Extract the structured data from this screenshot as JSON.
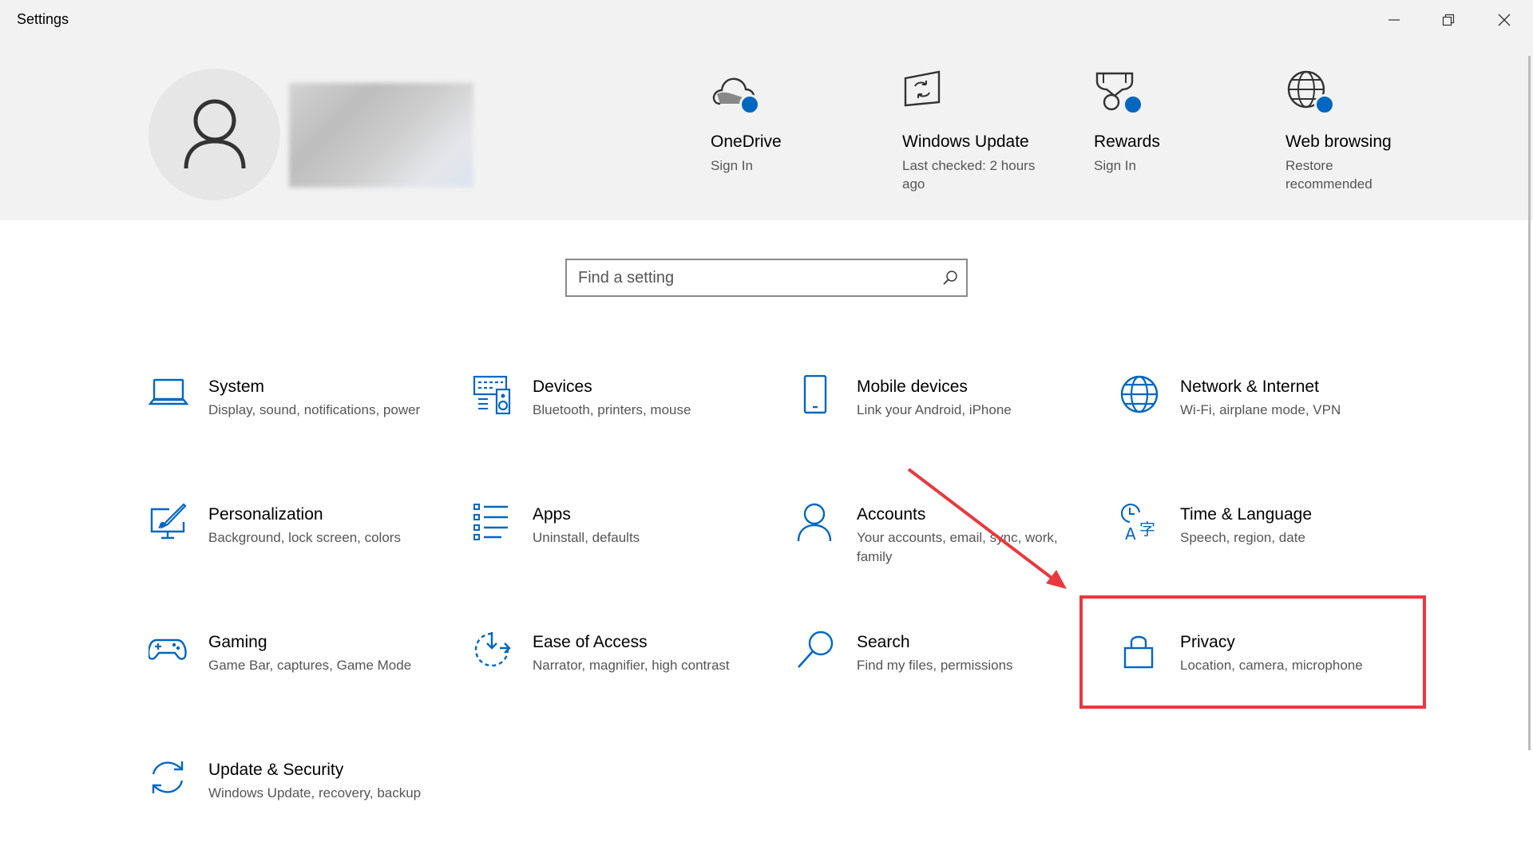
{
  "window": {
    "title": "Settings"
  },
  "header": {
    "quick_tiles": [
      {
        "title": "OneDrive",
        "subtitle": "Sign In",
        "icon": "onedrive-cloud-icon"
      },
      {
        "title": "Windows Update",
        "subtitle": "Last checked: 2 hours ago",
        "icon": "windows-update-icon"
      },
      {
        "title": "Rewards",
        "subtitle": "Sign In",
        "icon": "rewards-trophy-icon"
      },
      {
        "title": "Web browsing",
        "subtitle": "Restore recommended",
        "icon": "globe-icon"
      }
    ]
  },
  "search": {
    "placeholder": "Find a setting",
    "value": ""
  },
  "categories": [
    {
      "title": "System",
      "subtitle": "Display, sound, notifications, power",
      "icon": "laptop-icon"
    },
    {
      "title": "Devices",
      "subtitle": "Bluetooth, printers, mouse",
      "icon": "keyboard-speaker-icon"
    },
    {
      "title": "Mobile devices",
      "subtitle": "Link your Android, iPhone",
      "icon": "phone-icon"
    },
    {
      "title": "Network & Internet",
      "subtitle": "Wi-Fi, airplane mode, VPN",
      "icon": "globe-icon"
    },
    {
      "title": "Personalization",
      "subtitle": "Background, lock screen, colors",
      "icon": "paint-brush-icon"
    },
    {
      "title": "Apps",
      "subtitle": "Uninstall, defaults",
      "icon": "apps-list-icon"
    },
    {
      "title": "Accounts",
      "subtitle": "Your accounts, email, sync, work, family",
      "icon": "person-icon"
    },
    {
      "title": "Time & Language",
      "subtitle": "Speech, region, date",
      "icon": "clock-language-icon"
    },
    {
      "title": "Gaming",
      "subtitle": "Game Bar, captures, Game Mode",
      "icon": "gamepad-icon"
    },
    {
      "title": "Ease of Access",
      "subtitle": "Narrator, magnifier, high contrast",
      "icon": "ease-of-access-icon"
    },
    {
      "title": "Search",
      "subtitle": "Find my files, permissions",
      "icon": "magnifier-icon"
    },
    {
      "title": "Privacy",
      "subtitle": "Location, camera, microphone",
      "icon": "lock-icon"
    },
    {
      "title": "Update & Security",
      "subtitle": "Windows Update, recovery, backup",
      "icon": "sync-arrows-icon"
    }
  ],
  "colors": {
    "accent": "#0067c0",
    "annotation": "#e8393f",
    "header_bg": "#f2f2f2"
  }
}
